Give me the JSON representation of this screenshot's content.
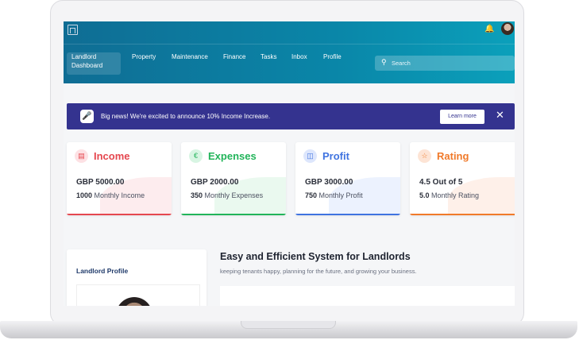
{
  "header": {
    "nav": [
      "Landlord Dashboard",
      "Property",
      "Maintenance",
      "Finance",
      "Tasks",
      "Inbox",
      "Profile"
    ],
    "search_placeholder": "Search"
  },
  "banner": {
    "text": "Big news! We're excited to announce 10% Income Increase.",
    "button": "Learn more",
    "close": "✕"
  },
  "cards": [
    {
      "title": "Income",
      "amount": "GBP 5000.00",
      "sub_value": "1000",
      "sub_label": "Monthly Income",
      "color": "#e5474f",
      "icon": "income-icon"
    },
    {
      "title": "Expenses",
      "amount": "GBP 2000.00",
      "sub_value": "350",
      "sub_label": "Monthly Expenses",
      "color": "#22b45a",
      "icon": "euro-icon"
    },
    {
      "title": "Profit",
      "amount": "GBP 3000.00",
      "sub_value": "750",
      "sub_label": "Monthly Profit",
      "color": "#3f73e0",
      "icon": "coins-icon"
    },
    {
      "title": "Rating",
      "amount": "4.5 Out of 5",
      "sub_value": "5.0",
      "sub_label": "Monthly Rating",
      "color": "#f07a2a",
      "icon": "star-icon"
    }
  ],
  "profile": {
    "title": "Landlord Profile"
  },
  "intro": {
    "heading": "Easy and Efficient System for Landlords",
    "tagline": "keeping tenants happy, planning for the future, and growing your business."
  }
}
